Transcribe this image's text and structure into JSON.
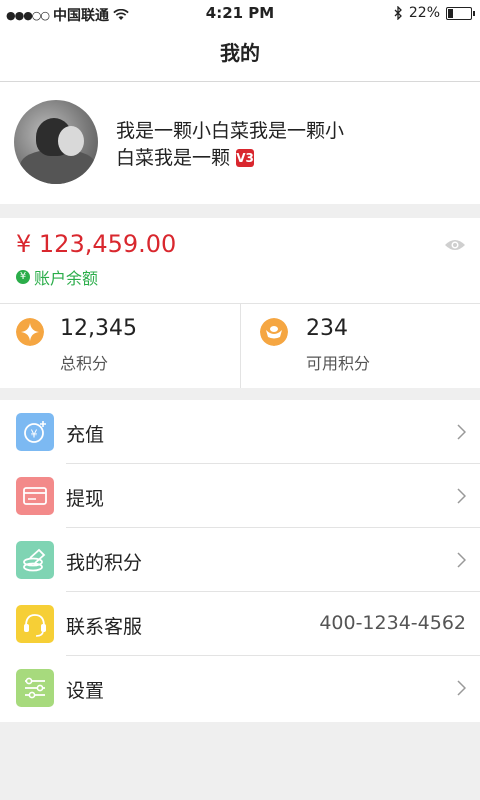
{
  "status": {
    "carrier": "中国联通",
    "time": "4:21 PM",
    "battery": "22%",
    "battery_level": 0.22
  },
  "nav": {
    "title": "我的"
  },
  "profile": {
    "name": "我是一颗小白菜我是一颗小白菜我是一颗",
    "badge": "V3"
  },
  "wallet": {
    "balance": "¥ 123,459.00",
    "balance_label": "账户余额",
    "total_points_value": "12,345",
    "total_points_label": "总积分",
    "available_points_value": "234",
    "available_points_label": "可用积分"
  },
  "menu": {
    "recharge": "充值",
    "withdraw": "提现",
    "my_points": "我的积分",
    "customer_service": "联系客服",
    "customer_service_phone": "400-1234-4562",
    "settings": "设置"
  },
  "colors": {
    "accent_red": "#d9272e",
    "accent_green": "#2bad4a",
    "recharge_tile": "#7cb9f2",
    "withdraw_tile": "#f38a8a",
    "points_tile": "#7fd4b3",
    "service_tile": "#f6cf36",
    "settings_tile": "#a7da7d",
    "points_icon": "#f5a642"
  },
  "icons": {
    "signal": "signal-dots-icon",
    "wifi": "wifi-icon",
    "bluetooth": "bluetooth-icon",
    "battery": "battery-icon",
    "eye": "eye-icon",
    "yen": "yen-circle-icon",
    "points": "star-coin-icon",
    "available": "ingot-icon",
    "recharge": "yen-coin-icon",
    "withdraw": "card-icon",
    "my_points": "coins-stack-icon",
    "service": "headset-icon",
    "settings": "sliders-icon",
    "chevron": "chevron-right-icon"
  }
}
